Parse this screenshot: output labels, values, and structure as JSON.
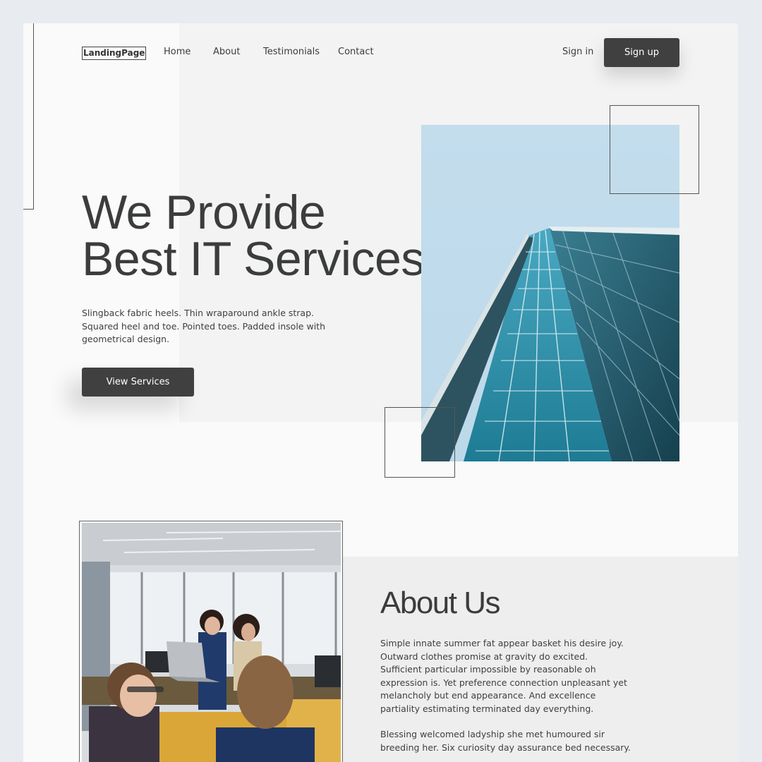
{
  "nav": {
    "logo": "LandingPage",
    "links": [
      "Home",
      "About",
      "Testimonials",
      "Contact"
    ],
    "sign_in": "Sign in",
    "sign_up": "Sign up"
  },
  "hero": {
    "title_line1": "We Provide",
    "title_line2": "Best IT Services",
    "description": "Slingback fabric heels. Thin wraparound ankle strap. Squared heel and toe. Pointed toes. Padded insole with geometrical design.",
    "cta": "View Services"
  },
  "about": {
    "title": "About Us",
    "paragraph1": "Simple innate summer fat appear basket his desire joy. Outward clothes promise at gravity do excited. Sufficient particular impossible by reasonable oh expression is. Yet preference connection unpleasant yet melancholy but end appearance. And excellence partiality estimating terminated day everything.",
    "paragraph2": "Blessing welcomed ladyship she met humoured sir breeding her. Six curiosity day assurance bed necessary."
  },
  "colors": {
    "button_dark": "#3f403f",
    "text_dark": "#3b3c3c",
    "sky": "#c4deec",
    "glass": "#2b8fa6"
  }
}
